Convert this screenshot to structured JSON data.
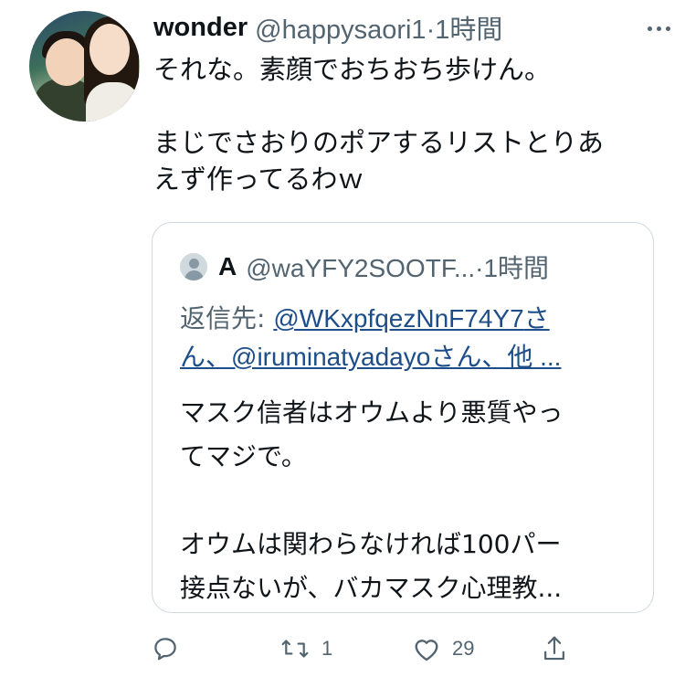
{
  "tweet": {
    "display_name": "wonder",
    "handle_meta": "@happysaori1·1時間",
    "text_lines": [
      "それな。素顔でおちおち歩けん。",
      "まじでさおりのポアするリストとりあ",
      "えず作ってるわｗ"
    ]
  },
  "quote": {
    "display_name": "A",
    "handle_meta": "@waYFY2SOOTF...·1時間",
    "reply_prefix": "返信先: ",
    "mention_1": "@WKxpfqezNnF74Y7",
    "mention_1_suffix": "さ",
    "line2_prefix": "ん、",
    "mention_2": "@iruminatyadayo",
    "line2_suffix": "さん、他 ...",
    "text_lines": [
      "マスク信者はオウムより悪質やっ",
      "てマジで。",
      "オウムは関わらなければ100パー",
      "接点ないが、バカマスク心理教..."
    ]
  },
  "actions": {
    "reply_count": "",
    "retweet_count": "1",
    "like_count": "29"
  },
  "colors": {
    "text": "#0f1419",
    "secondary": "#536471",
    "link": "#1d4e89",
    "border": "#cfd9de"
  }
}
